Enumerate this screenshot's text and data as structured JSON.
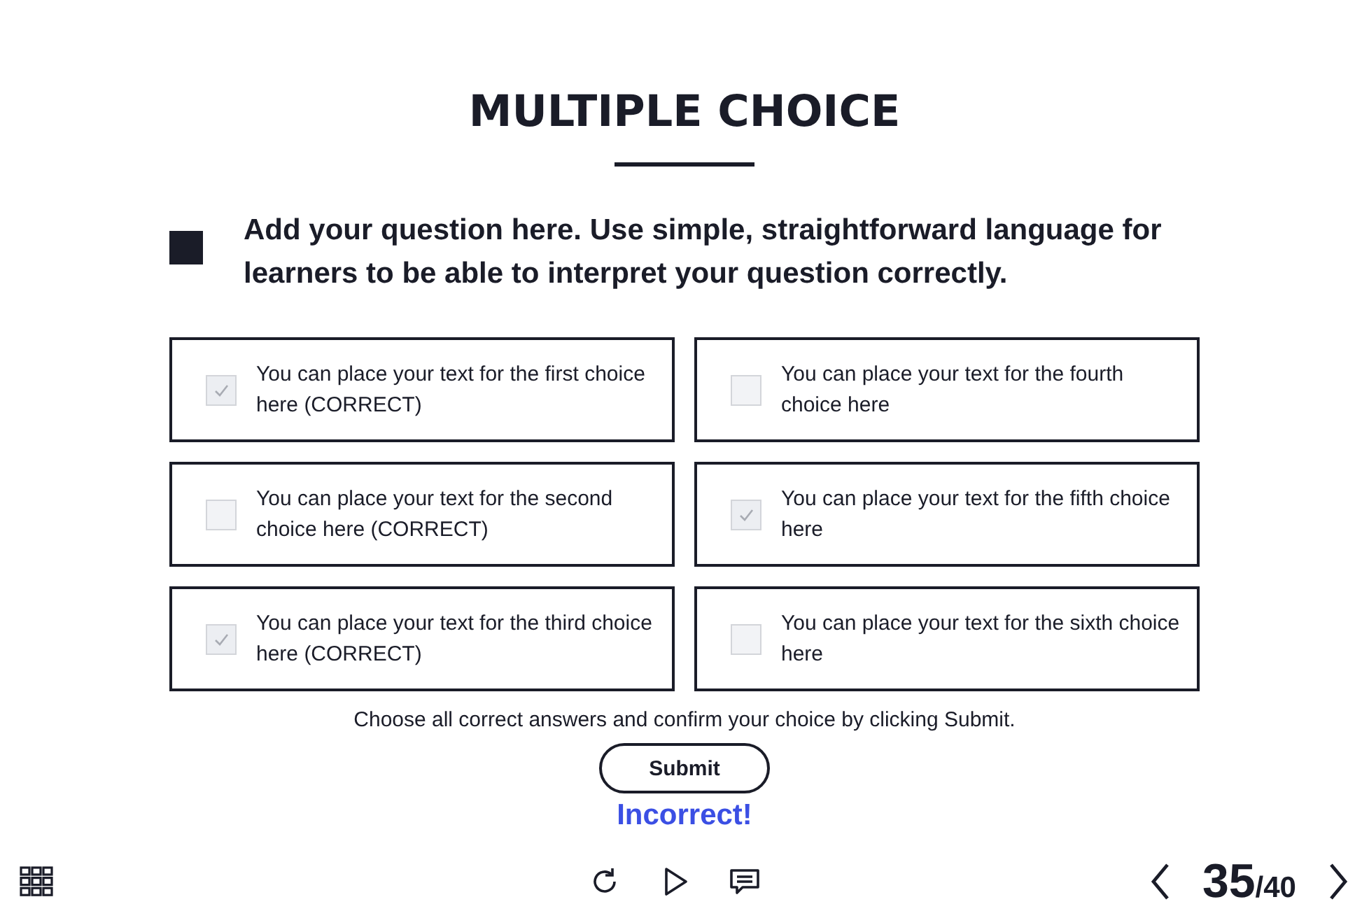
{
  "title": "MULTIPLE CHOICE",
  "question": "Add your question here. Use simple, straightforward language for learners to be able to interpret your question correctly.",
  "choices": [
    {
      "text": "You can place your text for the first choice here (CORRECT)",
      "checked": true
    },
    {
      "text": "You can place your text for the fourth choice here",
      "checked": false
    },
    {
      "text": "You can place your text for the second choice here (CORRECT)",
      "checked": false
    },
    {
      "text": "You can place your text for the fifth choice here",
      "checked": true
    },
    {
      "text": "You can place your text for the third choice here (CORRECT)",
      "checked": true
    },
    {
      "text": "You can place your text for the sixth choice here",
      "checked": false
    }
  ],
  "instruction": "Choose all correct answers and confirm your choice by clicking Submit.",
  "submit_button": "Submit",
  "feedback": "Incorrect!",
  "pager": {
    "current": "35",
    "total": "/40"
  }
}
